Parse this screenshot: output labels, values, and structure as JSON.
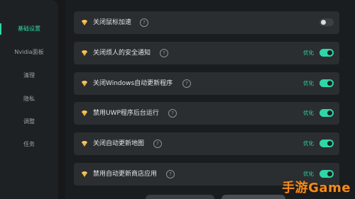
{
  "sidebar": {
    "items": [
      {
        "label": "基础设置",
        "active": true
      },
      {
        "label": "Nvidia面板",
        "active": false
      },
      {
        "label": "清理",
        "active": false
      },
      {
        "label": "隐私",
        "active": false
      },
      {
        "label": "调整",
        "active": false
      },
      {
        "label": "任务",
        "active": false
      }
    ]
  },
  "settings": {
    "optimize_tag": "优化",
    "help_glyph": "?",
    "rows": [
      {
        "label": "关闭鼠标加速",
        "optimized": false,
        "toggle": "off"
      },
      {
        "label": "关闭烦人的安全通知",
        "optimized": true,
        "toggle": "on"
      },
      {
        "label": "关闭Windows自动更新程序",
        "optimized": true,
        "toggle": "on"
      },
      {
        "label": "禁用UWP程序后台运行",
        "optimized": true,
        "toggle": "on"
      },
      {
        "label": "关闭自动更新地图",
        "optimized": true,
        "toggle": "on"
      },
      {
        "label": "禁用自动更新商店应用",
        "optimized": true,
        "toggle": "on"
      }
    ]
  },
  "watermark": {
    "text": "手游Game"
  },
  "colors": {
    "accent": "#2fd6a8",
    "diamond": "#f2b23a",
    "watermark": "#f28b1c"
  },
  "icons": {
    "row_icon": "diamond-icon",
    "help_icon": "question-circle-icon"
  }
}
